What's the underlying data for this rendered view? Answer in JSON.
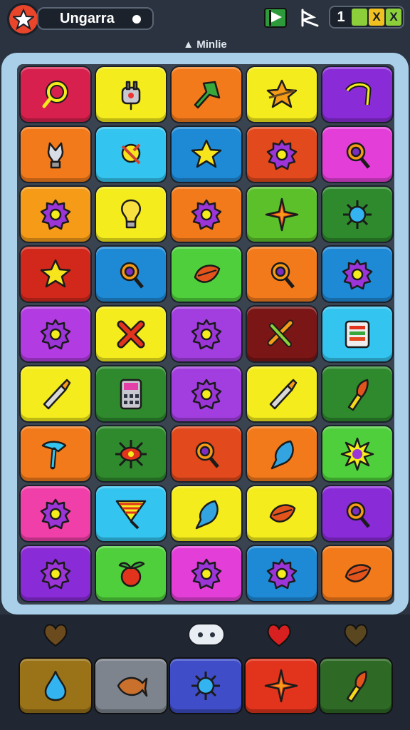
{
  "header": {
    "title": "Ungarra",
    "subtitle": "Minlie",
    "counter_value": "1",
    "counter_cells": [
      {
        "text": "",
        "color": "#8ccf3a"
      },
      {
        "text": "X",
        "color": "#f0c020"
      },
      {
        "text": "X",
        "color": "#8ccf3a"
      }
    ],
    "icons": [
      "star-icon",
      "flag-icon",
      "boat-icon"
    ]
  },
  "colors": {
    "background": "#2b3340",
    "board_frame": "#a9cfe9",
    "tray": "#202733"
  },
  "board": {
    "columns": 5,
    "rows": 9,
    "tiles": [
      {
        "color": "#d8204e",
        "icon": "ring"
      },
      {
        "color": "#f4ec1c",
        "icon": "plug"
      },
      {
        "color": "#f27a1a",
        "icon": "arrow"
      },
      {
        "color": "#f4ec1c",
        "icon": "star-bug"
      },
      {
        "color": "#8a2bd8",
        "icon": "hook"
      },
      {
        "color": "#f27a1a",
        "icon": "lightbulb-claw"
      },
      {
        "color": "#33c4f0",
        "icon": "spinner"
      },
      {
        "color": "#1e8ad6",
        "icon": "star"
      },
      {
        "color": "#e2491c",
        "icon": "gear"
      },
      {
        "color": "#e33fd8",
        "icon": "magnifier"
      },
      {
        "color": "#f59b18",
        "icon": "gear"
      },
      {
        "color": "#f4ec1c",
        "icon": "lightbulb"
      },
      {
        "color": "#f27a1a",
        "icon": "gear"
      },
      {
        "color": "#5cc02a",
        "icon": "sparkle"
      },
      {
        "color": "#2e8a2c",
        "icon": "virus"
      },
      {
        "color": "#d2281c",
        "icon": "star"
      },
      {
        "color": "#1e8ad6",
        "icon": "magnifier"
      },
      {
        "color": "#4fcf3c",
        "icon": "leaf"
      },
      {
        "color": "#f27a1a",
        "icon": "magnifier"
      },
      {
        "color": "#1e8ad6",
        "icon": "gear"
      },
      {
        "color": "#b23be2",
        "icon": "gear"
      },
      {
        "color": "#f4ec1c",
        "icon": "cross"
      },
      {
        "color": "#a23ee0",
        "icon": "gear"
      },
      {
        "color": "#7a1616",
        "icon": "pencil-cross"
      },
      {
        "color": "#33c4f0",
        "icon": "panel"
      },
      {
        "color": "#f4ec1c",
        "icon": "crayon"
      },
      {
        "color": "#2e8a2c",
        "icon": "calculator"
      },
      {
        "color": "#a23ee0",
        "icon": "gear"
      },
      {
        "color": "#f4ec1c",
        "icon": "crayon"
      },
      {
        "color": "#2e8a2c",
        "icon": "torch"
      },
      {
        "color": "#f27a1a",
        "icon": "hammer"
      },
      {
        "color": "#2e8a2c",
        "icon": "eye-burst"
      },
      {
        "color": "#e2491c",
        "icon": "magnifier"
      },
      {
        "color": "#f27a1a",
        "icon": "drop-leaf"
      },
      {
        "color": "#4fcf3c",
        "icon": "burst"
      },
      {
        "color": "#f03fa8",
        "icon": "gear"
      },
      {
        "color": "#33c4f0",
        "icon": "rainbow-flag"
      },
      {
        "color": "#f4ec1c",
        "icon": "drop-leaf"
      },
      {
        "color": "#f4ec1c",
        "icon": "leaf"
      },
      {
        "color": "#8a2bd8",
        "icon": "magnifier"
      },
      {
        "color": "#8a2bd8",
        "icon": "gear"
      },
      {
        "color": "#4fcf3c",
        "icon": "fruit"
      },
      {
        "color": "#e33fd8",
        "icon": "gear"
      },
      {
        "color": "#1e8ad6",
        "icon": "gear"
      },
      {
        "color": "#f27a1a",
        "icon": "leaf"
      }
    ]
  },
  "tray": {
    "top_icons": [
      "heart",
      "toggle",
      "heart",
      "heart"
    ],
    "tiles": [
      {
        "color": "#9a7318",
        "icon": "drop"
      },
      {
        "color": "#7d848e",
        "icon": "fish"
      },
      {
        "color": "#3f4ec8",
        "icon": "virus"
      },
      {
        "color": "#e2341c",
        "icon": "sparkle"
      },
      {
        "color": "#2e6a26",
        "icon": "torch"
      }
    ]
  }
}
